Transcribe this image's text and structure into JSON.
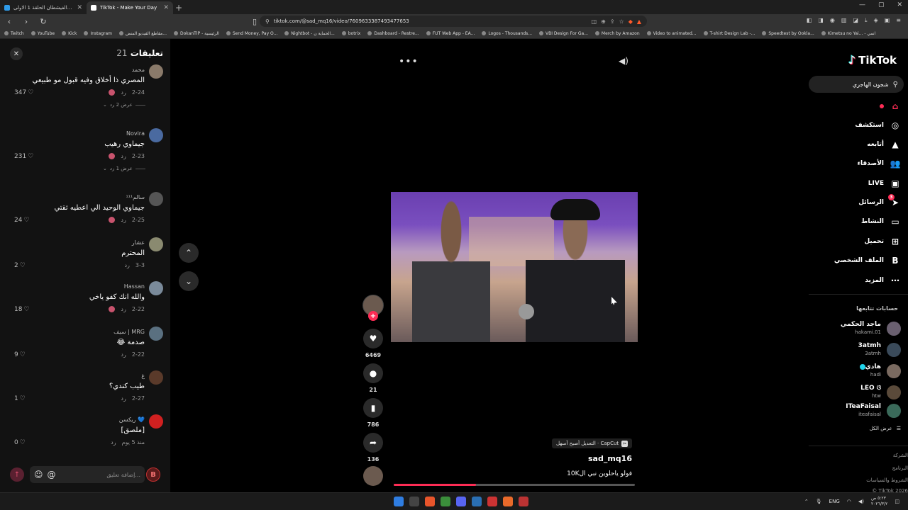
{
  "browser": {
    "tabs": [
      {
        "title": "مسلسل تاكلهم الفيشطان الحلقة 1 الاولى",
        "active": false
      },
      {
        "title": "TikTok - Make Your Day",
        "active": true
      }
    ],
    "url": "tiktok.com/@sad_mq16/video/7609633387493477653",
    "bookmarks": [
      "Twitch",
      "YouTube",
      "Kick",
      "Instagram",
      "مقاطع الفيديو المنض...",
      "DokanTIP - الرئيسية",
      "Send Money, Pay O...",
      "Nightbot - الحماية ن...",
      "botrix",
      "Dashboard - Restre...",
      "FUT Web App - EA...",
      "Logos - Thousands...",
      "VBI Design For Ga...",
      "Merch by Amazon",
      "Video to animated...",
      "T-shirt Design Lab -...",
      "Speedtest by Ookla...",
      "Kimetsu no Yai... - انمي"
    ]
  },
  "comments_panel": {
    "title": "تعليقات",
    "count": "21",
    "reply_label": "رد",
    "comments": [
      {
        "user": "محمد",
        "text": "المصري ذا أخلاق وفيه قبول مو طبيعي",
        "date": "2-24",
        "likes": "347",
        "replies": "عرض 2 رد"
      },
      {
        "user": "Novira",
        "text": "جيماوي رهيب",
        "date": "2-23",
        "likes": "231",
        "replies": "عرض 1 رد"
      },
      {
        "user": "سالم¹¹¹",
        "text": "جيماوي الوحيد الي اعطيه ثقتي",
        "date": "2-25",
        "likes": "24",
        "replies": ""
      },
      {
        "user": "عشار",
        "text": "المحترم",
        "date": "3-3",
        "likes": "2",
        "replies": ""
      },
      {
        "user": "Hassan",
        "text": "والله انك كفو ياخي",
        "date": "2-22",
        "likes": "18",
        "replies": ""
      },
      {
        "user": "سيف | MRG",
        "text": "صدمة 😂",
        "date": "2-22",
        "likes": "9",
        "replies": ""
      },
      {
        "user": "غ",
        "text": "طيب كندي؟",
        "date": "2-27",
        "likes": "1",
        "replies": ""
      },
      {
        "user": "ريكسن 💙",
        "text": "[ملصق]",
        "date": "منذ 5 يوم",
        "likes": "0",
        "replies": ""
      }
    ],
    "input_placeholder": "إضافة تعليق..."
  },
  "video": {
    "likes": "6469",
    "comments": "21",
    "saves": "786",
    "shares": "136",
    "capcut_label": "CapCut · التعديل أصبح أسهل",
    "author": "sad_mq16",
    "caption": "فولو ياحلوين نبي ال10K",
    "progress": 0.34
  },
  "sidebar": {
    "logo": "TikTok",
    "search_query": "شجون الهاجري",
    "nav": [
      {
        "label": "",
        "icon": "home-icon",
        "active": true
      },
      {
        "label": "استكشف",
        "icon": "compass-icon"
      },
      {
        "label": "أتابعه",
        "icon": "following-icon"
      },
      {
        "label": "الأصدقاء",
        "icon": "friends-icon"
      },
      {
        "label": "LIVE",
        "icon": "live-icon"
      },
      {
        "label": "الرسائل",
        "icon": "messages-icon",
        "badge": "3"
      },
      {
        "label": "النشاط",
        "icon": "activity-icon"
      },
      {
        "label": "تحميل",
        "icon": "upload-icon"
      },
      {
        "label": "الملف الشخصي",
        "icon": "profile-icon"
      },
      {
        "label": "المزيد",
        "icon": "more-icon"
      }
    ],
    "following_title": "حسابات تتابعها",
    "following": [
      {
        "name": "ماجد الحكمي",
        "handle": "hakami.01",
        "verified": false
      },
      {
        "name": "3atmh",
        "handle": "3atmh",
        "verified": false
      },
      {
        "name": "هادي",
        "handle": "hadi",
        "verified": true
      },
      {
        "name": "LEO ଓ",
        "handle": "htw",
        "verified": false
      },
      {
        "name": "ITeaFaisal",
        "handle": "iteafaisal",
        "verified": false
      }
    ],
    "see_all": "عرض الكل",
    "footer": [
      "الشركة",
      "البرنامج",
      "الشروط والسياسات",
      "TikTok 2026 ©"
    ]
  },
  "taskbar": {
    "lang": "ENG",
    "time": "٥:٢٣ ص",
    "date": "٢٠٢٦/٣/٢"
  }
}
